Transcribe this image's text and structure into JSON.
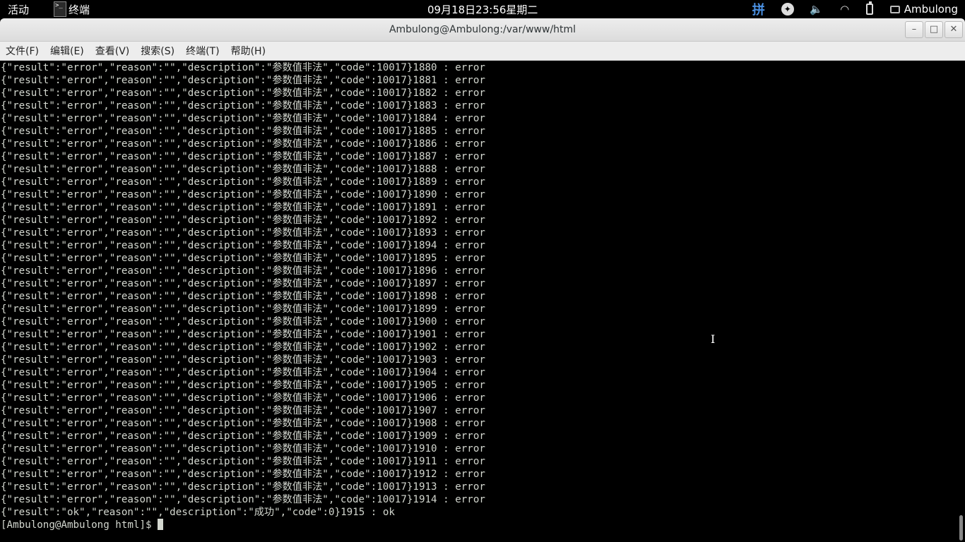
{
  "topbar": {
    "activities": "活动",
    "app_name": "终端",
    "app_icon_text": ">_",
    "clock": "09月18日23:56星期二",
    "ime": "拼",
    "accessibility": "✦",
    "volume": "🔈",
    "wifi": "◠",
    "user": "Ambulong"
  },
  "window": {
    "title": "Ambulong@Ambulong:/var/www/html",
    "minimize": "–",
    "maximize": "□",
    "close": "✕"
  },
  "menu": [
    "文件(F)",
    "编辑(E)",
    "查看(V)",
    "搜索(S)",
    "终端(T)",
    "帮助(H)"
  ],
  "terminal": {
    "lines": [
      "{\"result\":\"error\",\"reason\":\"\",\"description\":\"参数值非法\",\"code\":10017}1880 : error",
      "{\"result\":\"error\",\"reason\":\"\",\"description\":\"参数值非法\",\"code\":10017}1881 : error",
      "{\"result\":\"error\",\"reason\":\"\",\"description\":\"参数值非法\",\"code\":10017}1882 : error",
      "{\"result\":\"error\",\"reason\":\"\",\"description\":\"参数值非法\",\"code\":10017}1883 : error",
      "{\"result\":\"error\",\"reason\":\"\",\"description\":\"参数值非法\",\"code\":10017}1884 : error",
      "{\"result\":\"error\",\"reason\":\"\",\"description\":\"参数值非法\",\"code\":10017}1885 : error",
      "{\"result\":\"error\",\"reason\":\"\",\"description\":\"参数值非法\",\"code\":10017}1886 : error",
      "{\"result\":\"error\",\"reason\":\"\",\"description\":\"参数值非法\",\"code\":10017}1887 : error",
      "{\"result\":\"error\",\"reason\":\"\",\"description\":\"参数值非法\",\"code\":10017}1888 : error",
      "{\"result\":\"error\",\"reason\":\"\",\"description\":\"参数值非法\",\"code\":10017}1889 : error",
      "{\"result\":\"error\",\"reason\":\"\",\"description\":\"参数值非法\",\"code\":10017}1890 : error",
      "{\"result\":\"error\",\"reason\":\"\",\"description\":\"参数值非法\",\"code\":10017}1891 : error",
      "{\"result\":\"error\",\"reason\":\"\",\"description\":\"参数值非法\",\"code\":10017}1892 : error",
      "{\"result\":\"error\",\"reason\":\"\",\"description\":\"参数值非法\",\"code\":10017}1893 : error",
      "{\"result\":\"error\",\"reason\":\"\",\"description\":\"参数值非法\",\"code\":10017}1894 : error",
      "{\"result\":\"error\",\"reason\":\"\",\"description\":\"参数值非法\",\"code\":10017}1895 : error",
      "{\"result\":\"error\",\"reason\":\"\",\"description\":\"参数值非法\",\"code\":10017}1896 : error",
      "{\"result\":\"error\",\"reason\":\"\",\"description\":\"参数值非法\",\"code\":10017}1897 : error",
      "{\"result\":\"error\",\"reason\":\"\",\"description\":\"参数值非法\",\"code\":10017}1898 : error",
      "{\"result\":\"error\",\"reason\":\"\",\"description\":\"参数值非法\",\"code\":10017}1899 : error",
      "{\"result\":\"error\",\"reason\":\"\",\"description\":\"参数值非法\",\"code\":10017}1900 : error",
      "{\"result\":\"error\",\"reason\":\"\",\"description\":\"参数值非法\",\"code\":10017}1901 : error",
      "{\"result\":\"error\",\"reason\":\"\",\"description\":\"参数值非法\",\"code\":10017}1902 : error",
      "{\"result\":\"error\",\"reason\":\"\",\"description\":\"参数值非法\",\"code\":10017}1903 : error",
      "{\"result\":\"error\",\"reason\":\"\",\"description\":\"参数值非法\",\"code\":10017}1904 : error",
      "{\"result\":\"error\",\"reason\":\"\",\"description\":\"参数值非法\",\"code\":10017}1905 : error",
      "{\"result\":\"error\",\"reason\":\"\",\"description\":\"参数值非法\",\"code\":10017}1906 : error",
      "{\"result\":\"error\",\"reason\":\"\",\"description\":\"参数值非法\",\"code\":10017}1907 : error",
      "{\"result\":\"error\",\"reason\":\"\",\"description\":\"参数值非法\",\"code\":10017}1908 : error",
      "{\"result\":\"error\",\"reason\":\"\",\"description\":\"参数值非法\",\"code\":10017}1909 : error",
      "{\"result\":\"error\",\"reason\":\"\",\"description\":\"参数值非法\",\"code\":10017}1910 : error",
      "{\"result\":\"error\",\"reason\":\"\",\"description\":\"参数值非法\",\"code\":10017}1911 : error",
      "{\"result\":\"error\",\"reason\":\"\",\"description\":\"参数值非法\",\"code\":10017}1912 : error",
      "{\"result\":\"error\",\"reason\":\"\",\"description\":\"参数值非法\",\"code\":10017}1913 : error",
      "{\"result\":\"error\",\"reason\":\"\",\"description\":\"参数值非法\",\"code\":10017}1914 : error",
      "{\"result\":\"ok\",\"reason\":\"\",\"description\":\"成功\",\"code\":0}1915 : ok"
    ],
    "prompt": "[Ambulong@Ambulong html]$ "
  },
  "colors": {
    "terminal_bg": "#000000",
    "terminal_fg": "#d3d7cf",
    "ime_accent": "#4a90e2"
  }
}
